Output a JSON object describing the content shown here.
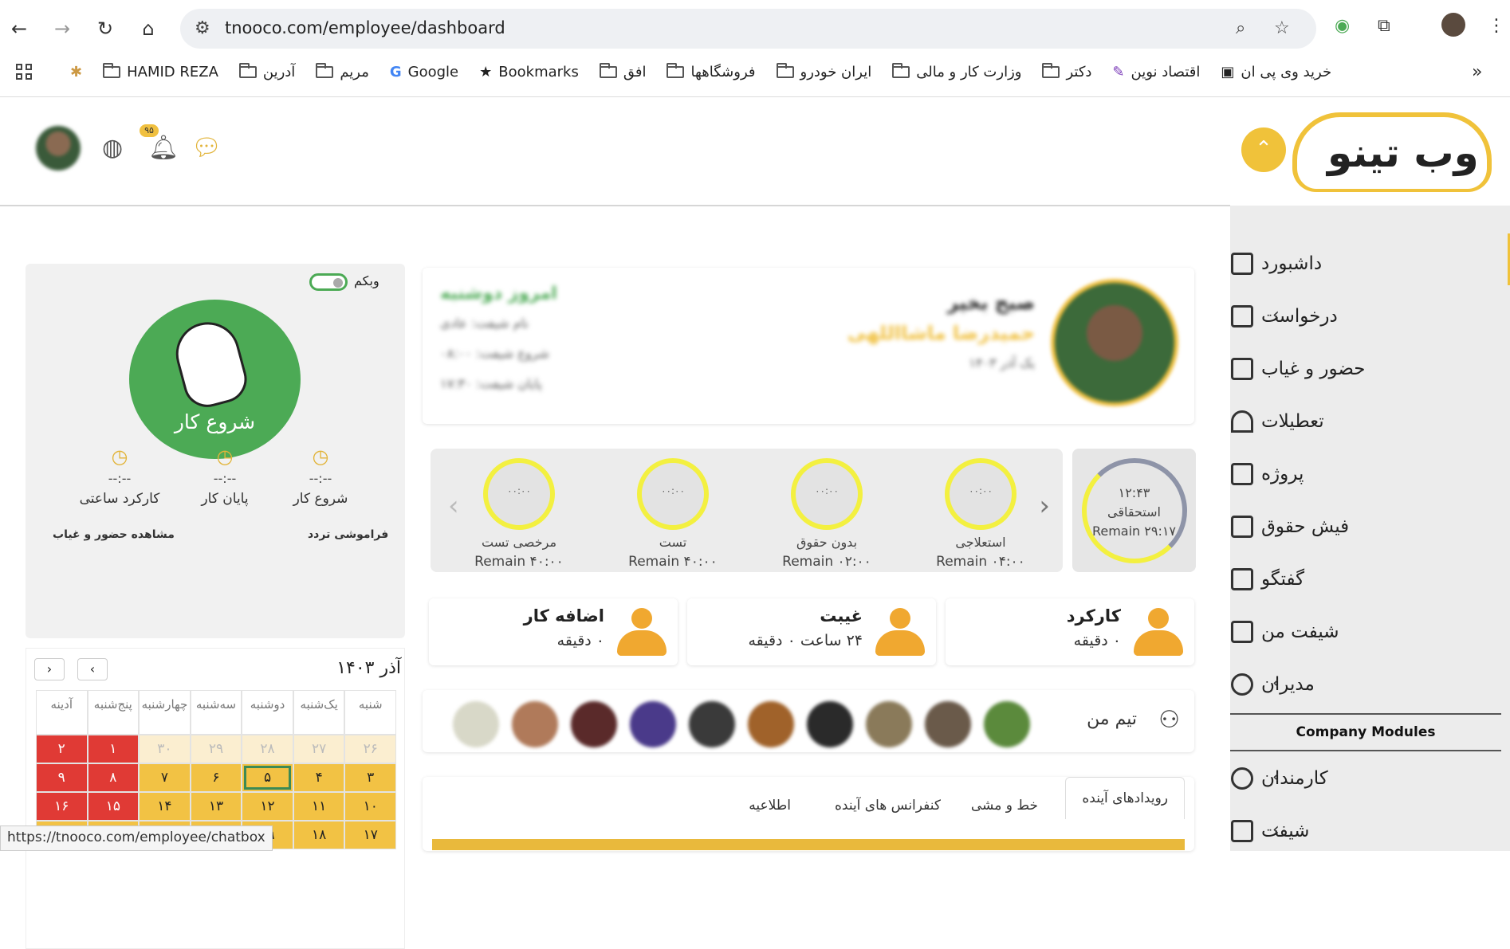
{
  "browser": {
    "url": "tnooco.com/employee/dashboard",
    "bookmarks": [
      "HAMID REZA",
      "آدرین",
      "مریم",
      "Google",
      "Bookmarks",
      "افق",
      "فروشگاهها",
      "ایران خودرو",
      "وزارت کار و مالی",
      "دکتر",
      "اقتصاد نوین",
      "خرید وی پی ان"
    ],
    "status_url": "https://tnooco.com/employee/chatbox"
  },
  "topbar": {
    "notifications_count": "۹۵"
  },
  "logo": {
    "text": "وب تینو"
  },
  "sidebar": {
    "items": [
      {
        "label": "داشبورد"
      },
      {
        "label": "درخواست"
      },
      {
        "label": "حضور و غیاب"
      },
      {
        "label": "تعطیلات"
      },
      {
        "label": "پروژه"
      },
      {
        "label": "فیش حقوق"
      },
      {
        "label": "گفتگو"
      },
      {
        "label": "شیفت من"
      },
      {
        "label": "مدیران"
      }
    ],
    "section_title": "Company Modules",
    "module_items": [
      {
        "label": "کارمندان"
      },
      {
        "label": "شیفت"
      }
    ]
  },
  "punch": {
    "webcam_label": "وبکم",
    "start_button": "شروع کار",
    "stats": [
      {
        "value": "--:--",
        "label": "شروع کار"
      },
      {
        "value": "--:--",
        "label": "پایان کار"
      },
      {
        "value": "--:--",
        "label": "کارکرد ساعتی"
      }
    ],
    "forgot_label": "فراموشی تردد",
    "view_attendance": "مشاهده حضور و غیاب"
  },
  "profile": {
    "greeting": "صبح بخیر",
    "name": "حمیدرضا ماشااللهی",
    "date": "یک آذر ۱۴۰۳",
    "today": "امروز دوشنبه",
    "shift_name": "نام شیفت: عادی",
    "shift_start": "شروع شیفت: ۰۸:۰۰",
    "shift_end": "پایان شیفت: ۱۷:۳۰"
  },
  "leave": {
    "main_time": "۱۲:۴۳",
    "main_label": "استحقاقی",
    "main_remain": "Remain ۲۹:۱۷",
    "gauges": [
      {
        "time": "۰۰:۰۰",
        "label": "استعلاجی",
        "remain": "Remain ۰۴:۰۰"
      },
      {
        "time": "۰۰:۰۰",
        "label": "بدون حقوق",
        "remain": "Remain ۰۲:۰۰"
      },
      {
        "time": "۰۰:۰۰",
        "label": "تست",
        "remain": "Remain ۴۰:۰۰"
      },
      {
        "time": "۰۰:۰۰",
        "label": "مرخصی تست",
        "remain": "Remain ۴۰:۰۰"
      }
    ]
  },
  "summary": [
    {
      "title": "کارکرد",
      "value": "۰ دقیقه"
    },
    {
      "title": "غیبت",
      "value": "۲۴ ساعت ۰ دقیقه"
    },
    {
      "title": "اضافه کار",
      "value": "۰ دقیقه"
    }
  ],
  "team": {
    "title": "تیم من"
  },
  "tabs": [
    {
      "label": "رویدادهای آینده"
    },
    {
      "label": "خط و مشی"
    },
    {
      "label": "کنفرانس های آینده"
    },
    {
      "label": "اطلاعیه"
    }
  ],
  "calendar": {
    "title": "آذر ۱۴۰۳",
    "weekdays": [
      "شنبه",
      "یک‌شنبه",
      "دوشنبه",
      "سه‌شنبه",
      "چهارشنبه",
      "پنج‌شنبه",
      "آدینه"
    ],
    "rows": [
      [
        "۲۶",
        "۲۷",
        "۲۸",
        "۲۹",
        "۳۰",
        "۱",
        "۲"
      ],
      [
        "۳",
        "۴",
        "۵",
        "۶",
        "۷",
        "۸",
        "۹"
      ],
      [
        "۱۰",
        "۱۱",
        "۱۲",
        "۱۳",
        "۱۴",
        "۱۵",
        "۱۶"
      ],
      [
        "۱۷",
        "۱۸",
        "۱۹",
        "",
        "",
        "",
        ""
      ]
    ]
  },
  "colors": {
    "accent": "#f0c23a",
    "green": "#4caa55",
    "red": "#e03a35"
  }
}
